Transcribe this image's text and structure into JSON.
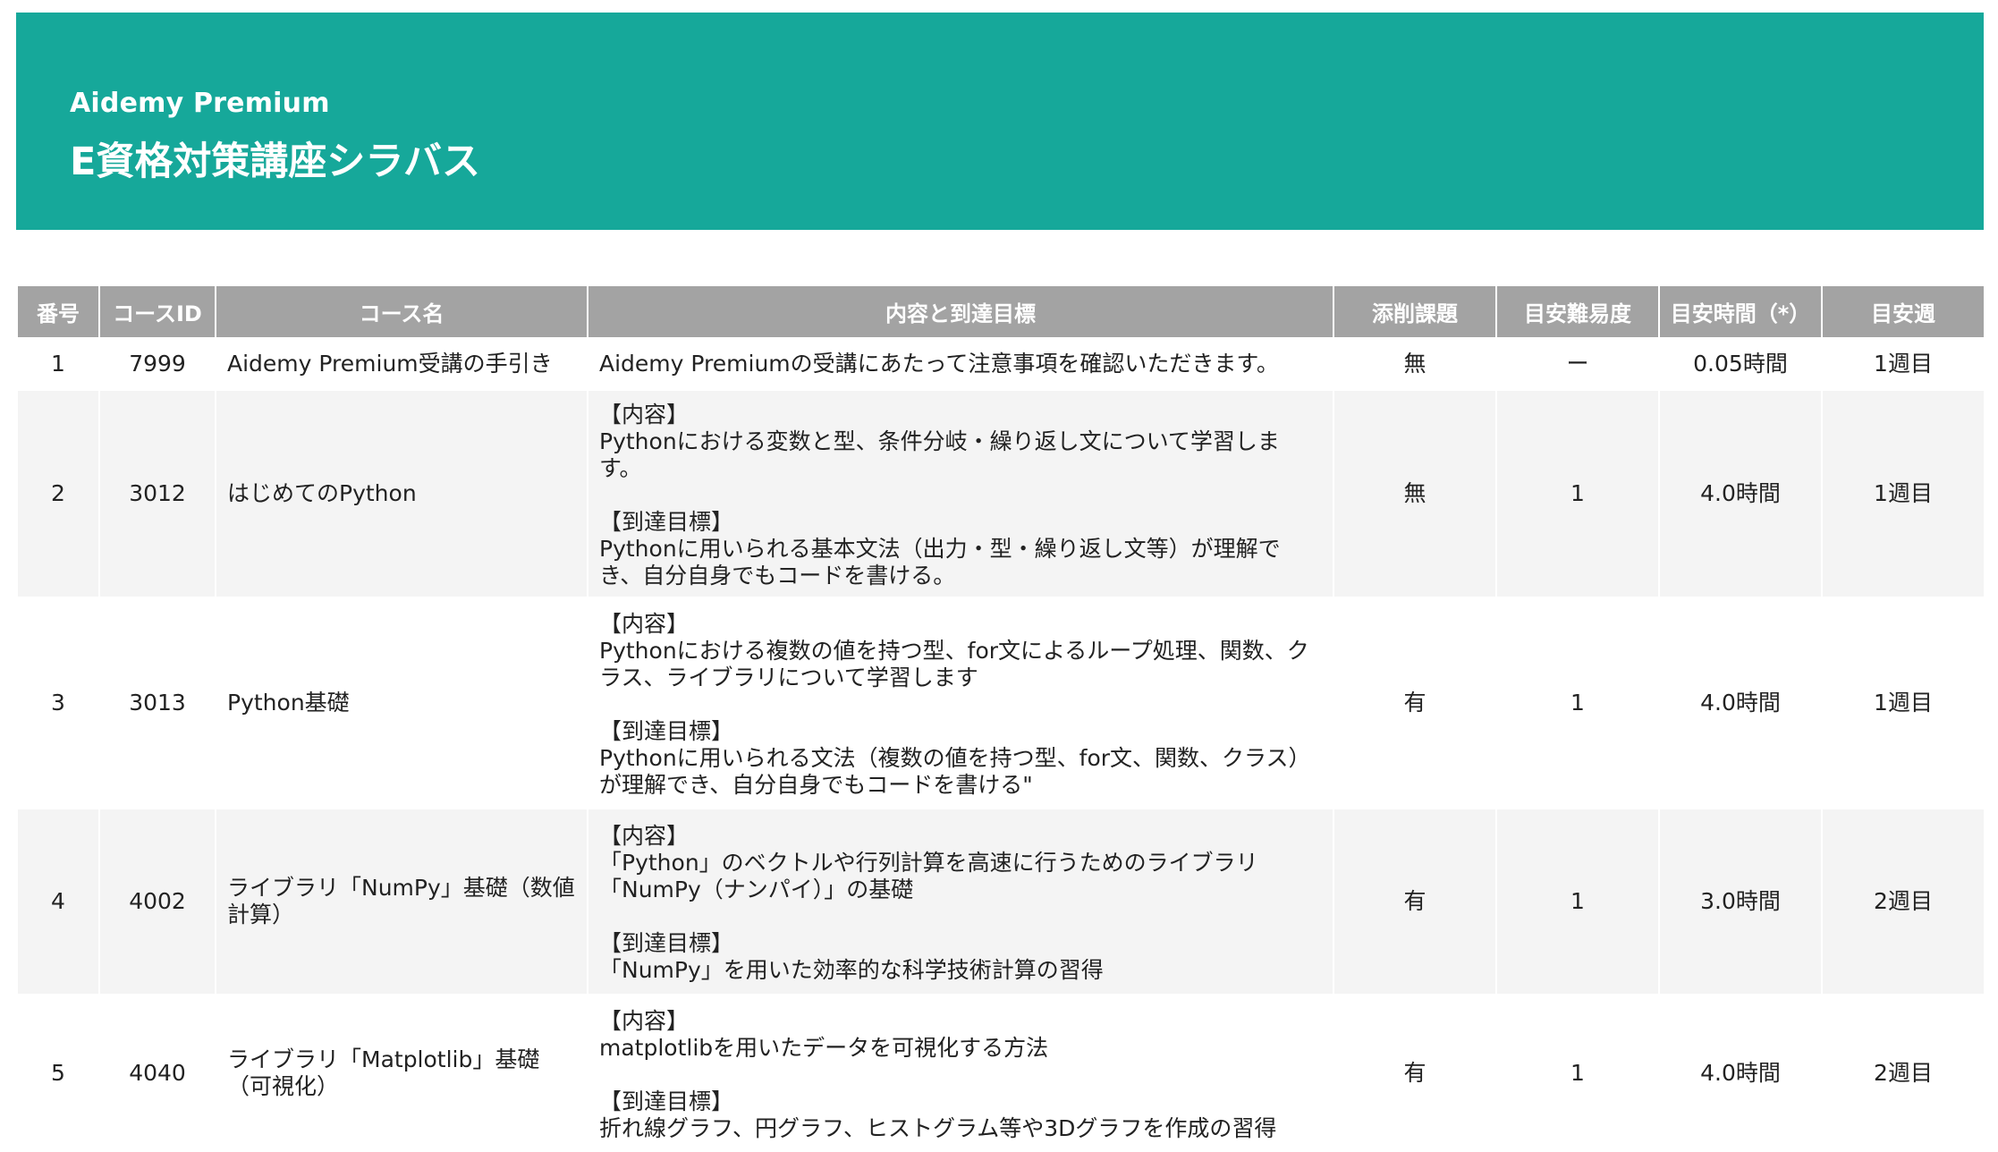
{
  "header": {
    "brand": "Aidemy Premium",
    "title": "E資格対策講座シラバス"
  },
  "table": {
    "columns": [
      "番号",
      "コースID",
      "コース名",
      "内容と到達目標",
      "添削課題",
      "目安難易度",
      "目安時間（*）",
      "目安週"
    ],
    "rows": [
      {
        "no": "1",
        "course_id": "7999",
        "name": "Aidemy Premium受講の手引き",
        "desc": "Aidemy Premiumの受講にあたって注意事項を確認いただきます。",
        "assignment": "無",
        "difficulty": "ー",
        "hours": "0.05時間",
        "week": "1週目"
      },
      {
        "no": "2",
        "course_id": "3012",
        "name": "はじめてのPython",
        "desc": "【内容】\nPythonにおける変数と型、条件分岐・繰り返し文について学習します。\n\n【到達目標】\nPythonに用いられる基本文法（出力・型・繰り返し文等）が理解でき、自分自身でもコードを書ける。",
        "assignment": "無",
        "difficulty": "1",
        "hours": "4.0時間",
        "week": "1週目"
      },
      {
        "no": "3",
        "course_id": "3013",
        "name": "Python基礎",
        "desc": "【内容】\nPythonにおける複数の値を持つ型、for文によるループ処理、関数、クラス、ライブラリについて学習します\n\n【到達目標】\nPythonに用いられる文法（複数の値を持つ型、for文、関数、クラス）が理解でき、自分自身でもコードを書ける\"",
        "assignment": "有",
        "difficulty": "1",
        "hours": "4.0時間",
        "week": "1週目"
      },
      {
        "no": "4",
        "course_id": "4002",
        "name": "ライブラリ「NumPy」基礎（数値計算）",
        "desc": "【内容】\n「Python」のベクトルや行列計算を高速に行うためのライブラリ「NumPy（ナンパイ）」の基礎\n\n【到達目標】\n「NumPy」を用いた効率的な科学技術計算の習得",
        "assignment": "有",
        "difficulty": "1",
        "hours": "3.0時間",
        "week": "2週目"
      },
      {
        "no": "5",
        "course_id": "4040",
        "name": "ライブラリ「Matplotlib」基礎（可視化）",
        "desc": "【内容】\nmatplotlibを用いたデータを可視化する方法\n\n【到達目標】\n折れ線グラフ、円グラフ、ヒストグラム等や3Dグラフを作成の習得",
        "assignment": "有",
        "difficulty": "1",
        "hours": "4.0時間",
        "week": "2週目"
      }
    ]
  }
}
